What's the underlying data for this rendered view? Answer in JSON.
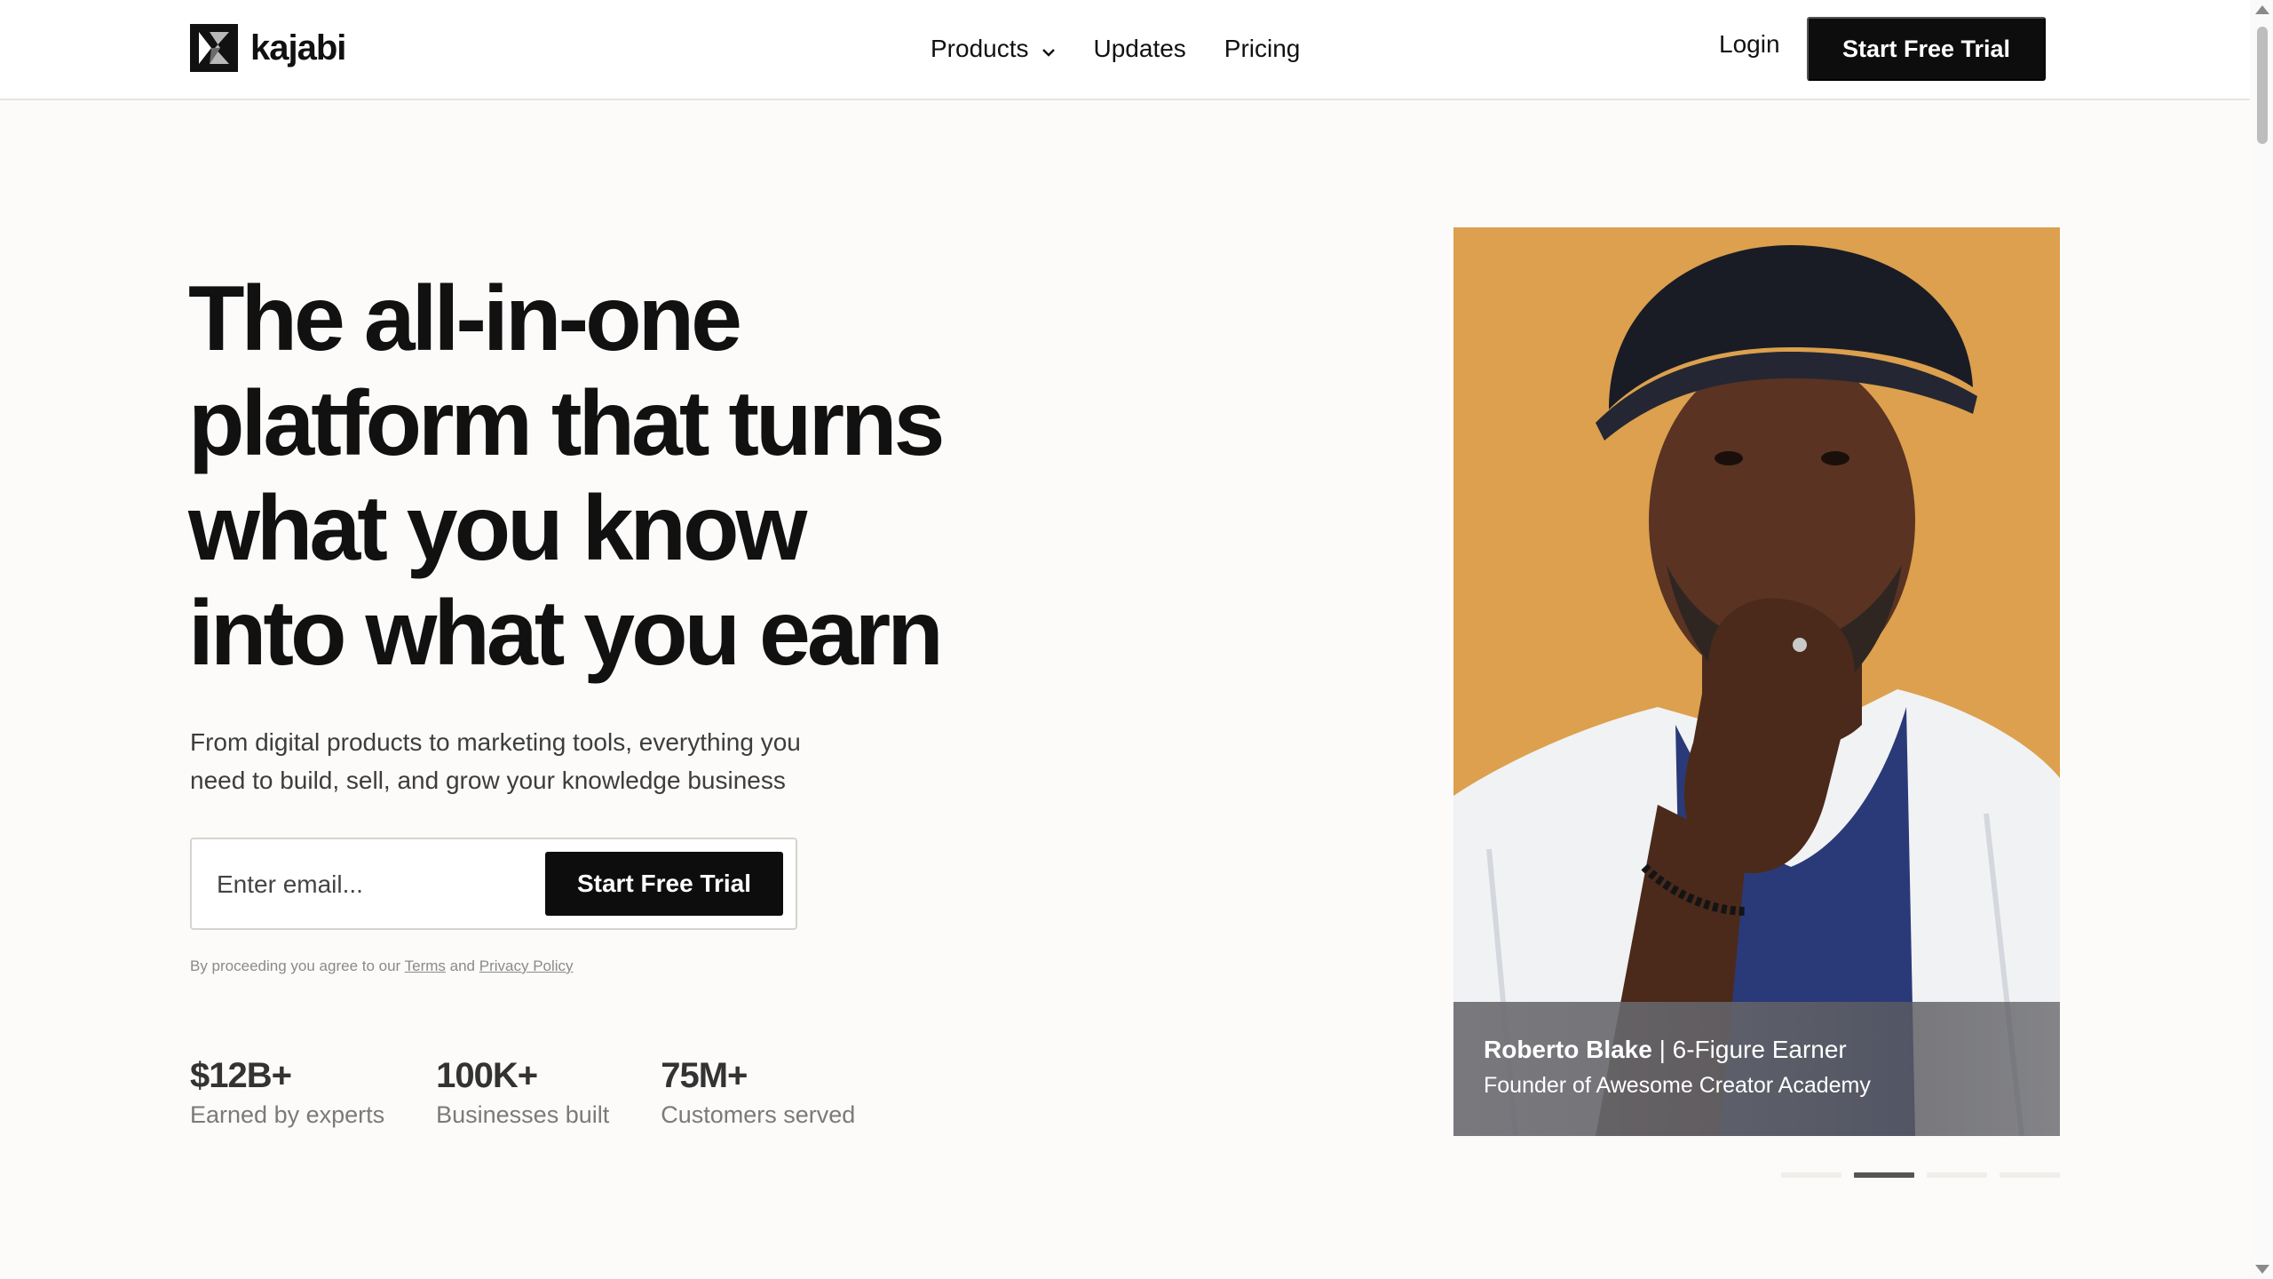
{
  "header": {
    "brand": "kajabi",
    "nav": [
      {
        "label": "Products",
        "has_dropdown": true
      },
      {
        "label": "Updates",
        "has_dropdown": false
      },
      {
        "label": "Pricing",
        "has_dropdown": false
      }
    ],
    "login": "Login",
    "cta": "Start Free Trial"
  },
  "hero": {
    "headline": [
      "The all-in-one",
      "platform that turns",
      "what you know",
      "into what you earn"
    ],
    "subhead": [
      "From digital products to marketing tools, everything you",
      "need to build, sell, and grow your knowledge business"
    ],
    "email_placeholder": "Enter email...",
    "submit_label": "Start Free Trial",
    "legal": {
      "prefix": "By proceeding you agree to our ",
      "terms": "Terms",
      "and": " and ",
      "privacy": "Privacy Policy"
    },
    "stats": [
      {
        "value": "$12B+",
        "label": "Earned by experts"
      },
      {
        "value": "100K+",
        "label": "Businesses built"
      },
      {
        "value": "75M+",
        "label": "Customers served"
      }
    ]
  },
  "testimonial": {
    "name": "Roberto Blake",
    "title_suffix": " | 6-Figure Earner",
    "role": "Founder of Awesome Creator Academy",
    "background_color": "#dca04e"
  },
  "carousel": {
    "total": 4,
    "active": 2
  },
  "icons": {
    "logo": "kajabi-logo-icon",
    "dropdown": "chevron-down-icon"
  },
  "colors": {
    "primary": "#0d0d0d",
    "page_bg": "#fcfbf9",
    "card_bg": "#dca04e"
  }
}
